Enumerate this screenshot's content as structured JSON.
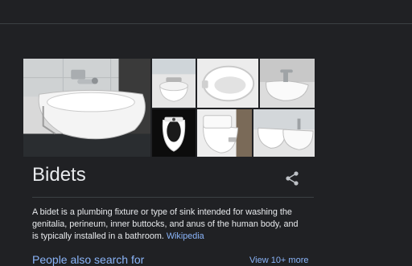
{
  "panel": {
    "title": "Bidets",
    "description": "A bidet is a plumbing fixture or type of sink intended for washing the genitalia, perineum, inner buttocks, and anus of the human body, and is typically installed in a bathroom.",
    "source_link": "Wikipedia",
    "people_also_search": "People also search for",
    "view_more": "View 10+ more",
    "share_icon": "share-icon",
    "gallery_icons": [
      "bidet-photo",
      "bidet-photo",
      "toilet-seat-photo",
      "bidet-photo",
      "bidet-seat-photo",
      "bidet-seat-photo",
      "bidet-photo"
    ]
  },
  "colors": {
    "background": "#202124",
    "text": "#e8eaed",
    "link": "#8ab4f8",
    "divider": "#3c4043"
  }
}
